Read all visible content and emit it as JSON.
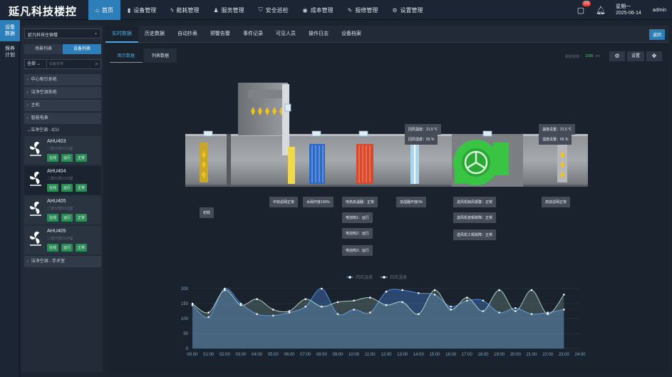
{
  "app": {
    "title": "延凡科技楼控"
  },
  "nav": [
    {
      "icon": "home-icon",
      "glyph": "⌂",
      "label": "首页",
      "active": true
    },
    {
      "icon": "device-icon",
      "glyph": "▮",
      "label": "设备管理"
    },
    {
      "icon": "energy-icon",
      "glyph": "ϟ",
      "label": "能耗管理"
    },
    {
      "icon": "service-icon",
      "glyph": "♟",
      "label": "服务管理"
    },
    {
      "icon": "shield-icon",
      "glyph": "⛉",
      "label": "安全巡检"
    },
    {
      "icon": "cost-icon",
      "glyph": "◉",
      "label": "成本管理"
    },
    {
      "icon": "wrench-icon",
      "glyph": "✎",
      "label": "报修管理"
    },
    {
      "icon": "gear-icon",
      "glyph": "⚙",
      "label": "设置管理"
    }
  ],
  "header": {
    "notif_count": "23",
    "weekday": "星期一",
    "date": "2025-06-14",
    "user": "admin"
  },
  "leftbar": [
    {
      "label1": "设备",
      "label2": "数据",
      "active": true
    },
    {
      "label1": "保养",
      "label2": "计划"
    }
  ],
  "sidebar": {
    "building": "延凡科技住宿楼",
    "tab_scene": "场景列表",
    "tab_device": "设备列表",
    "filter_all": "全部",
    "search_placeholder": "设备名称",
    "groups": [
      {
        "label": "中心吸引系统"
      },
      {
        "label": "洁净空调系统"
      },
      {
        "label": "主机"
      },
      {
        "label": "智能电表"
      }
    ],
    "open_group": "洁净空调 - ICU",
    "devices": [
      {
        "name": "AHU403",
        "loc": "二楼分部ICU1室",
        "s1": "在线",
        "s2": "运行",
        "s3": "正常",
        "selected": false
      },
      {
        "name": "AHU404",
        "loc": "二楼分部ICU2室",
        "s1": "在线",
        "s2": "运行",
        "s3": "正常",
        "selected": true
      },
      {
        "name": "AHU405",
        "loc": "二楼分部ICU3室",
        "s1": "在线",
        "s2": "运行",
        "s3": "正常",
        "selected": false
      },
      {
        "name": "AHU405",
        "loc": "二楼分部ICU4室",
        "s1": "在线",
        "s2": "运行",
        "s3": "正常",
        "selected": false
      }
    ],
    "last_group": "洁净空调 - 手术室"
  },
  "tabs": [
    "实时数据",
    "历史数据",
    "自动抄表",
    "预警告警",
    "事件记录",
    "可见人员",
    "操作日志",
    "设备档案"
  ],
  "back_label": "返回",
  "subtabs": [
    "图示数据",
    "列表数据"
  ],
  "tools": {
    "rate_label": "刷新频率：",
    "rate_value": "1000",
    "rate_unit": "ms",
    "settings_label": "设置"
  },
  "diagram": {
    "return_temp": "回风温度：21.5 ℃",
    "return_hum": "回风湿度：65 %",
    "set_temp": "温度设置：21.5 ℃",
    "set_hum": "湿度设置：65 %",
    "primary": "初效",
    "medium": "中效滤网正常",
    "valve": "水阀开度100%",
    "heater": "电热高温器：正常",
    "heat1": "电加热1：运行",
    "heat2": "电加热2：运行",
    "heat3": "电加热3：运行",
    "humid": "加湿器开度0%",
    "fan1": "送风机缺风报警：正常",
    "fan2": "送风机变频故障：正常",
    "fan3": "送风机工频故障：正常",
    "hepa": "高效滤网正常"
  },
  "chart_data": {
    "type": "area",
    "series": [
      {
        "name": "回风温度",
        "color": "#4f8de8",
        "values": [
          145,
          105,
          200,
          150,
          115,
          110,
          120,
          140,
          200,
          115,
          130,
          120,
          190,
          195,
          185,
          180,
          140,
          160,
          160,
          120,
          135,
          115,
          120,
          130
        ]
      },
      {
        "name": "回风湿度",
        "color": "#a8d0c0",
        "values": [
          150,
          120,
          195,
          145,
          165,
          130,
          125,
          165,
          140,
          155,
          160,
          170,
          145,
          155,
          115,
          195,
          130,
          170,
          125,
          195,
          125,
          195,
          115,
          180
        ]
      }
    ],
    "x": [
      "00:00",
      "01:00",
      "02:00",
      "03:00",
      "04:00",
      "05:00",
      "06:00",
      "07:00",
      "08:00",
      "09:00",
      "10:00",
      "11:00",
      "12:00",
      "13:00",
      "14:00",
      "15:00",
      "16:00",
      "17:00",
      "18:00",
      "19:00",
      "20:00",
      "21:00",
      "22:00",
      "23:00",
      "24:00"
    ],
    "yticks": [
      0,
      50,
      100,
      150,
      200
    ],
    "ylim": [
      0,
      200
    ],
    "grid": true,
    "legend": "top-center"
  }
}
